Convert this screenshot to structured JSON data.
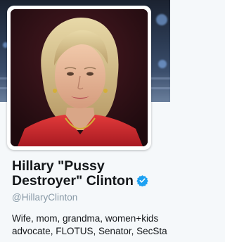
{
  "profile": {
    "display_name_line1": "Hillary \"Pussy",
    "display_name_line2": "Destroyer\" Clinton",
    "screen_name": "@HillaryClinton",
    "bio_line1": "Wife, mom, grandma, women+kids",
    "bio_line2": "advocate, FLOTUS, Senator, SecSta",
    "verified": true
  },
  "colors": {
    "verified_blue": "#1da1f2",
    "page_background": "#f5f8fa",
    "name_text": "#14171a",
    "handle_text": "#8899a6"
  },
  "icons": {
    "verified": "verified-badge-icon"
  }
}
